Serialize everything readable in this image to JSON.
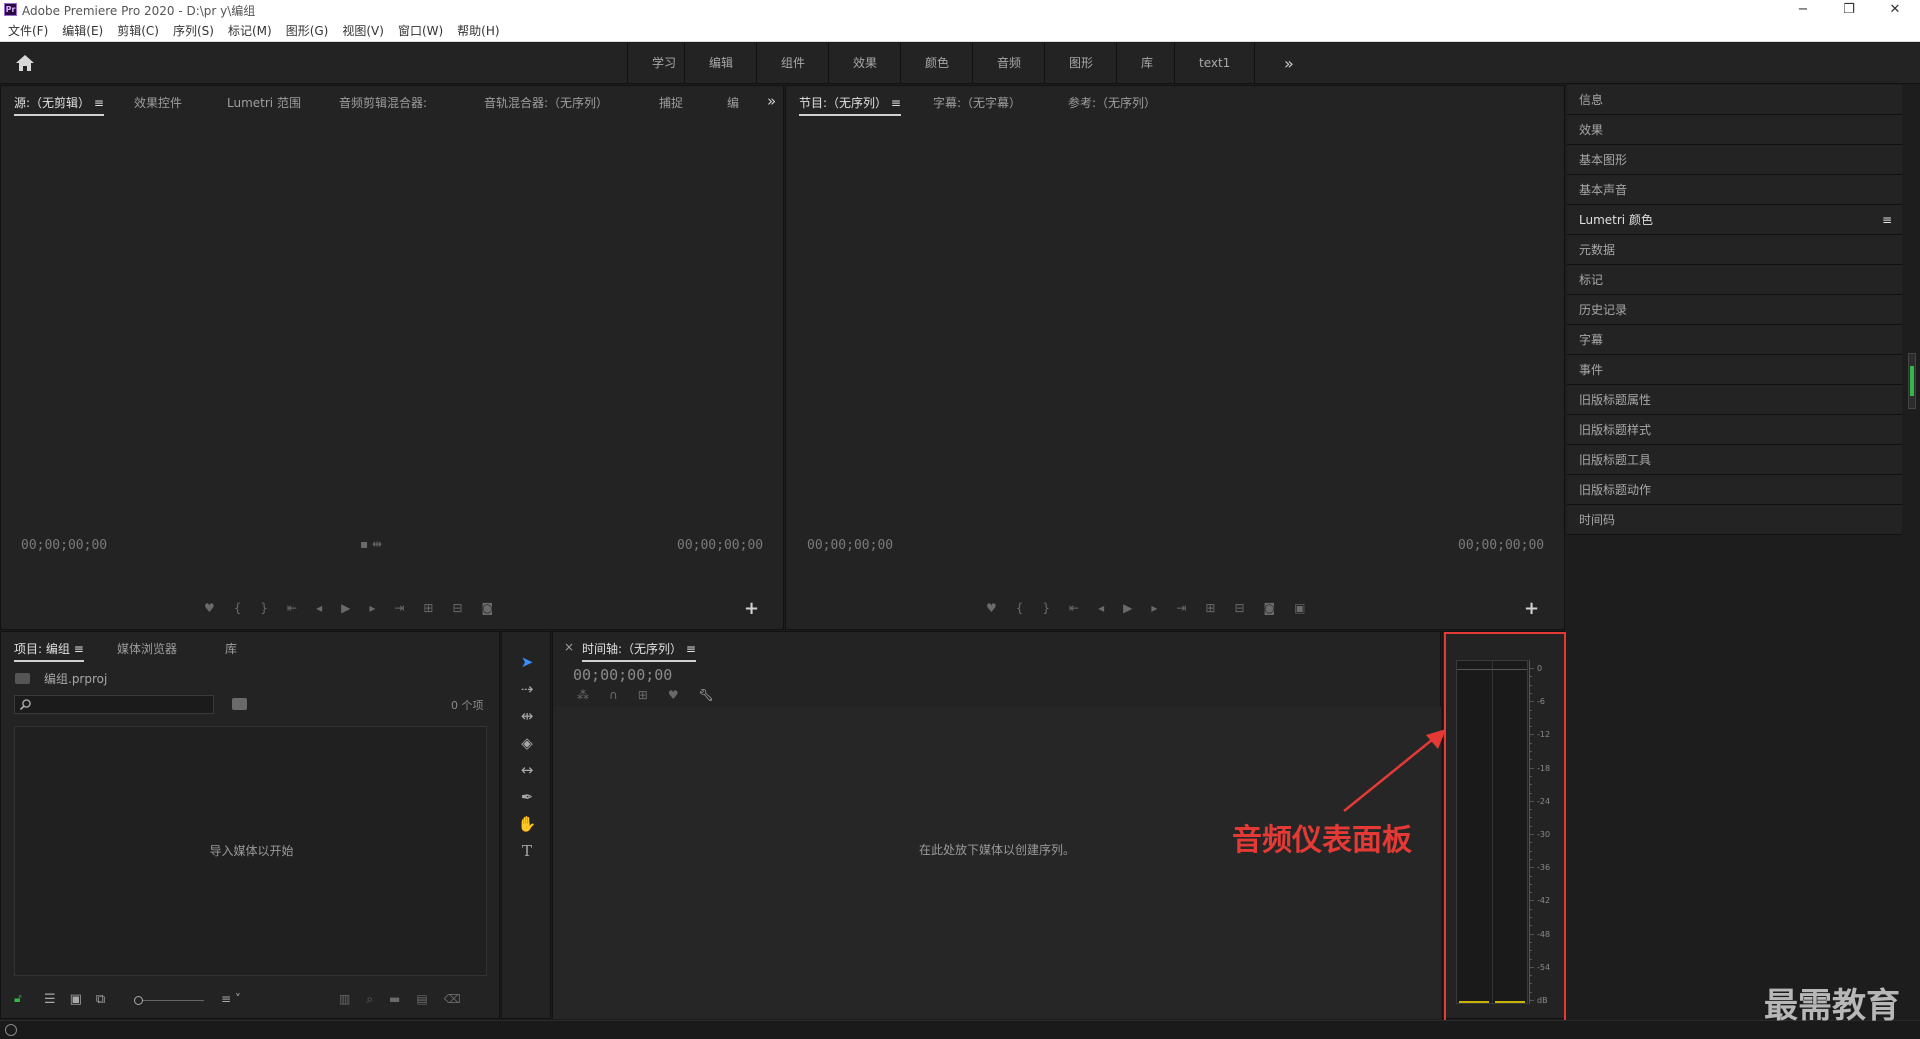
{
  "titlebar": {
    "logo": "Pr",
    "title": "Adobe Premiere Pro 2020 - D:\\pr y\\编组",
    "min": "−",
    "max": "❐",
    "close": "✕"
  },
  "menu": [
    "文件(F)",
    "编辑(E)",
    "剪辑(C)",
    "序列(S)",
    "标记(M)",
    "图形(G)",
    "视图(V)",
    "窗口(W)",
    "帮助(H)"
  ],
  "workspaces": [
    "学习",
    "编辑",
    "组件",
    "效果",
    "颜色",
    "音频",
    "图形",
    "库",
    "text1"
  ],
  "ws_more": "»",
  "source": {
    "tabs": [
      "源:（无剪辑）",
      "效果控件",
      "Lumetri 范围",
      "音频剪辑混合器:",
      "音轨混合器:（无序列）",
      "捕捉",
      "编"
    ],
    "menu_icon": "≡",
    "more": "»",
    "tc_left": "00;00;00;00",
    "tc_right": "00;00;00;00",
    "plus": "+"
  },
  "program": {
    "tabs": [
      "节目:（无序列）",
      "字幕:（无字幕）",
      "参考:（无序列）"
    ],
    "menu_icon": "≡",
    "tc_left": "00;00;00;00",
    "tc_right": "00;00;00;00",
    "plus": "+"
  },
  "right_panels": [
    "信息",
    "效果",
    "基本图形",
    "基本声音",
    "Lumetri 颜色",
    "元数据",
    "标记",
    "历史记录",
    "字幕",
    "事件",
    "旧版标题属性",
    "旧版标题样式",
    "旧版标题工具",
    "旧版标题动作",
    "时间码"
  ],
  "right_menu_icon": "≡",
  "project": {
    "tabs": [
      "项目: 编组",
      "媒体浏览器",
      "库"
    ],
    "menu_icon": "≡",
    "file": "编组.prproj",
    "count": "0 个项",
    "empty": "导入媒体以开始",
    "search_placeholder": ""
  },
  "timeline": {
    "close": "×",
    "tab": "时间轴:（无序列）",
    "menu_icon": "≡",
    "tc": "00;00;00;00",
    "empty": "在此处放下媒体以创建序列。"
  },
  "meter": {
    "labels": [
      "0",
      "-6",
      "-12",
      "-18",
      "-24",
      "-30",
      "-36",
      "-42",
      "-48",
      "-54",
      "dB"
    ]
  },
  "annotation": {
    "text": "音频仪表面板",
    "color": "#e53935"
  },
  "watermark": "最需教育"
}
